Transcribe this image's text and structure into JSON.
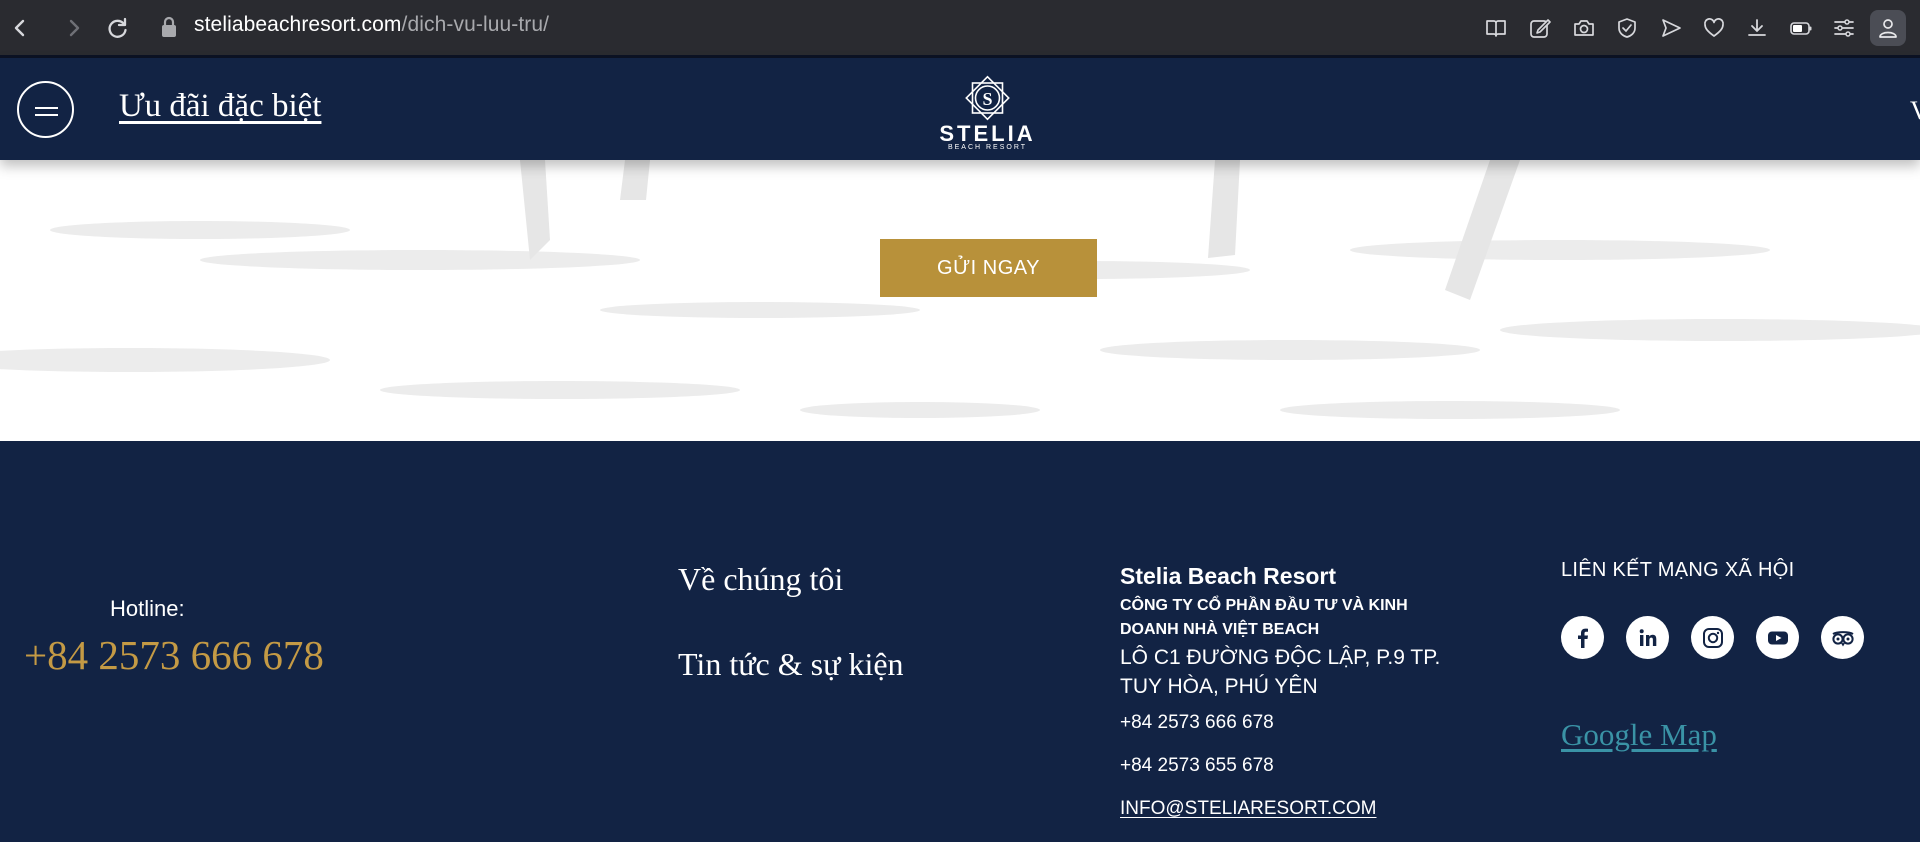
{
  "browser": {
    "url_domain": "steliabeachresort.com",
    "url_path": "/dich-vu-luu-tru/",
    "icons": [
      "back-icon",
      "forward-icon",
      "reload-icon",
      "lock-icon",
      "reader-icon",
      "edit-icon",
      "camera-icon",
      "shield-icon",
      "send-icon",
      "heart-icon",
      "download-icon",
      "battery-icon",
      "menu-lines-icon",
      "profile-icon"
    ]
  },
  "header": {
    "special_offer_label": "Ưu đãi đặc biệt",
    "logo_name": "STELIA",
    "logo_sub": "BEACH RESORT",
    "edge_char": "V"
  },
  "form": {
    "submit_label": "GỬI NGAY"
  },
  "footer": {
    "hotline_label": "Hotline:",
    "hotline_number": "+84 2573 666 678",
    "links": [
      "Về chúng tôi",
      "Tin tức & sự kiện"
    ],
    "company": {
      "name": "Stelia Beach Resort",
      "legal_name": "CÔNG TY CỔ PHẦN ĐẦU TƯ VÀ KINH DOANH NHÀ VIỆT BEACH",
      "address": "LÔ C1 ĐƯỜNG ĐỘC LẬP, P.9 TP. TUY HÒA, PHÚ YÊN",
      "phone_1": "+84 2573 666 678",
      "phone_2": "+84 2573 655 678",
      "email": "INFO@STELIARESORT.COM"
    },
    "social_title": "LIÊN KẾT MẠNG XÃ HỘI",
    "social": [
      "facebook-icon",
      "linkedin-icon",
      "instagram-icon",
      "youtube-icon",
      "tripadvisor-icon"
    ],
    "google_map_label": "Google Map"
  },
  "colors": {
    "navy": "#122344",
    "gold": "#b8913a",
    "hotline_gold": "#c49a45",
    "map_teal": "#3a93a6",
    "chrome": "#2a2b30"
  }
}
